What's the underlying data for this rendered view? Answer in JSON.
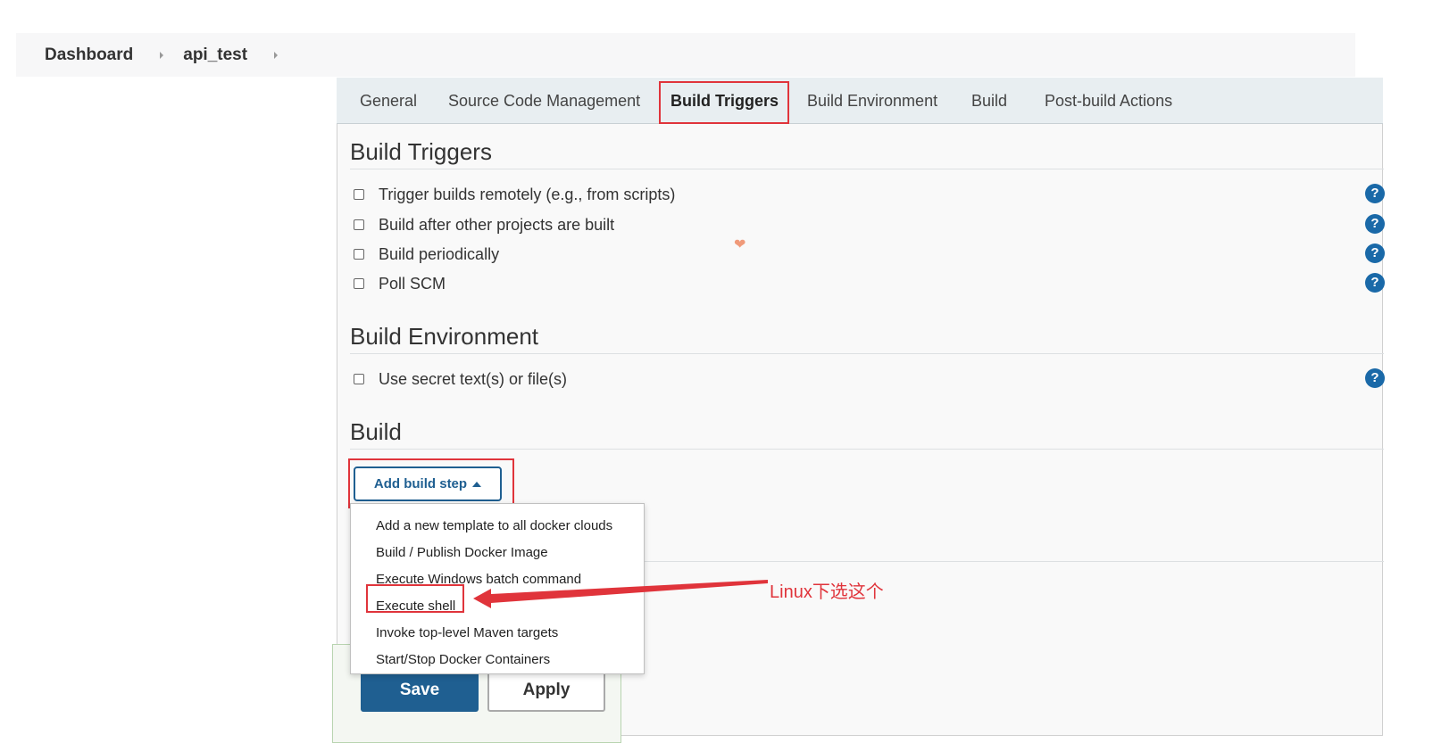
{
  "breadcrumb": {
    "items": [
      "Dashboard",
      "api_test"
    ]
  },
  "tabs": [
    {
      "label": "General"
    },
    {
      "label": "Source Code Management"
    },
    {
      "label": "Build Triggers"
    },
    {
      "label": "Build Environment"
    },
    {
      "label": "Build"
    },
    {
      "label": "Post-build Actions"
    }
  ],
  "build_triggers": {
    "title": "Build Triggers",
    "options": [
      {
        "label": "Trigger builds remotely (e.g., from scripts)"
      },
      {
        "label": "Build after other projects are built"
      },
      {
        "label": "Build periodically"
      },
      {
        "label": "Poll SCM"
      }
    ]
  },
  "build_environment": {
    "title": "Build Environment",
    "options": [
      {
        "label": "Use secret text(s) or file(s)"
      }
    ]
  },
  "build": {
    "title": "Build",
    "add_step_label": "Add build step",
    "menu_items": [
      "Add a new template to all docker clouds",
      "Build / Publish Docker Image",
      "Execute Windows batch command",
      "Execute shell",
      "Invoke top-level Maven targets",
      "Start/Stop Docker Containers"
    ]
  },
  "help_symbol": "?",
  "footer": {
    "save_label": "Save",
    "apply_label": "Apply"
  },
  "annotation": {
    "text": "Linux下选这个",
    "color": "#e0343b"
  },
  "colors": {
    "primary": "#1f5f91",
    "help": "#1a69a8",
    "highlight": "#e0343b"
  }
}
